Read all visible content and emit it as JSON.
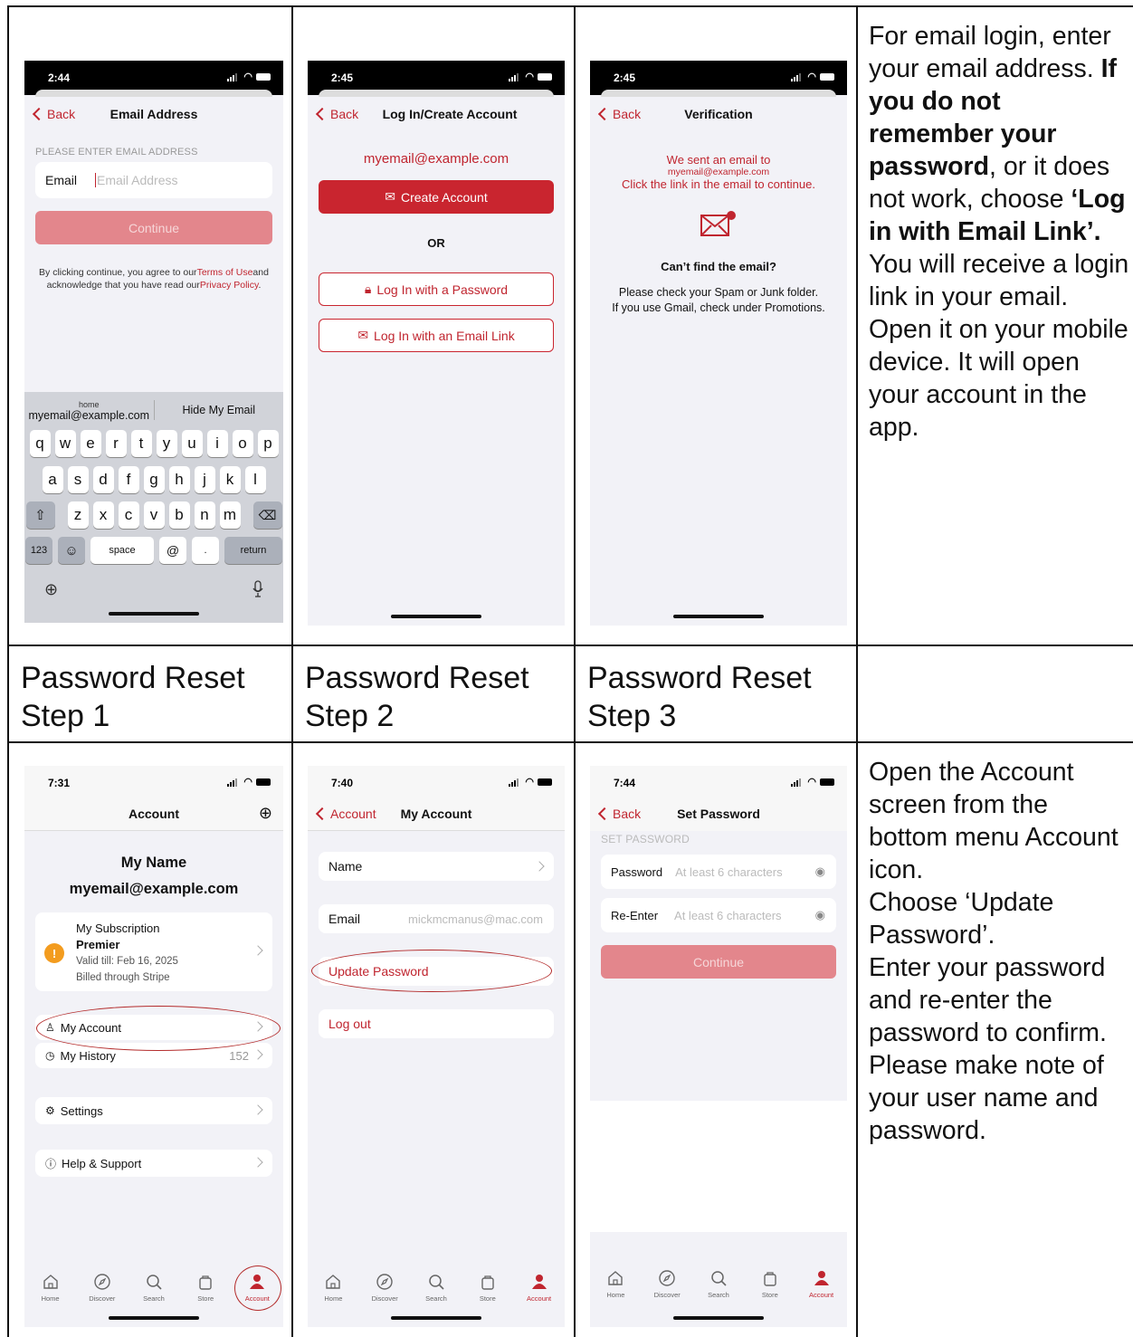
{
  "colors": {
    "accent": "#c0252f",
    "accent_faded": "#e3868c",
    "bg": "#f2f2f7"
  },
  "descriptions": {
    "top": {
      "p1": "For email login, enter your email address. ",
      "p2": "If you do not remember your password",
      "p3": ", or it does not work, choose ",
      "p4": "‘Log in with Email Link’.",
      "p5": "You will receive a login link in your email. Open it on your mobile device. It will open your account in the app."
    },
    "bottom": {
      "p1": "Open the Account screen from the bottom menu Account icon.",
      "p2": "Choose ‘Update Password’.",
      "p3": "Enter your password and re-enter the password to confirm.",
      "p4": "Please make note of your user name and password."
    }
  },
  "step_titles": [
    "Password Reset Step 1",
    "Password Reset Step 2",
    "Password Reset Step 3"
  ],
  "screen_email": {
    "time": "2:44",
    "back": "Back",
    "title": "Email Address",
    "section": "PLEASE ENTER EMAIL ADDRESS",
    "field_label": "Email",
    "field_placeholder": "Email Address",
    "continue": "Continue",
    "terms_a": "By clicking continue, you agree to our",
    "terms_link1": "Terms of Use",
    "terms_b": "and acknowledge that you have read our",
    "terms_link2": "Privacy Policy",
    "terms_c": ".",
    "suggest_small": "home",
    "suggest_email": "myemail@example.com",
    "suggest_hide": "Hide My Email",
    "row1": [
      "q",
      "w",
      "e",
      "r",
      "t",
      "y",
      "u",
      "i",
      "o",
      "p"
    ],
    "row2": [
      "a",
      "s",
      "d",
      "f",
      "g",
      "h",
      "j",
      "k",
      "l"
    ],
    "row3": [
      "z",
      "x",
      "c",
      "v",
      "b",
      "n",
      "m"
    ],
    "k123": "123",
    "space": "space",
    "at": "@",
    "dot": ".",
    "return": "return"
  },
  "screen_login": {
    "time": "2:45",
    "back": "Back",
    "title": "Log In/Create Account",
    "email": "myemail@example.com",
    "create": "Create Account",
    "or": "OR",
    "with_password": "Log In with a Password",
    "with_link": "Log In with an Email Link"
  },
  "screen_verify": {
    "time": "2:45",
    "back": "Back",
    "title": "Verification",
    "line1": "We sent an email to",
    "line2": "myemail@example.com",
    "line3": "Click the link in the email to continue.",
    "cant_find": "Can’t find the email?",
    "help1": "Please check your Spam or Junk folder.",
    "help2": "If you use Gmail, check under Promotions."
  },
  "screen_account": {
    "time": "7:31",
    "title": "Account",
    "name": "My Name",
    "email": "myemail@example.com",
    "sub_label": "My Subscription",
    "sub_plan": "Premier",
    "sub_valid": "Valid till: Feb 16, 2025",
    "sub_billing": "Billed through Stripe",
    "my_account": "My Account",
    "my_history": "My History",
    "history_count": "152",
    "settings": "Settings",
    "help": "Help & Support"
  },
  "screen_myaccount": {
    "time": "7:40",
    "back": "Account",
    "title": "My Account",
    "name": "Name",
    "email_label": "Email",
    "email_value": "mickmcmanus@mac.com",
    "update_password": "Update Password",
    "logout": "Log out"
  },
  "screen_setpw": {
    "time": "7:44",
    "back": "Back",
    "title": "Set Password",
    "section": "SET PASSWORD",
    "pw_label": "Password",
    "pw_placeholder": "At least 6 characters",
    "re_label": "Re-Enter",
    "re_placeholder": "At least 6 characters",
    "continue": "Continue"
  },
  "tabbar": [
    "Home",
    "Discover",
    "Search",
    "Store",
    "Account"
  ]
}
